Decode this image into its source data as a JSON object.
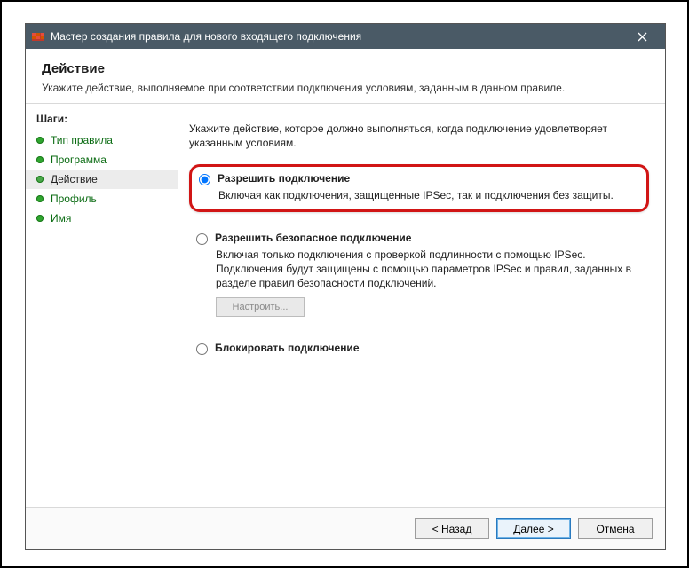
{
  "window": {
    "title": "Мастер создания правила для нового входящего подключения"
  },
  "header": {
    "title": "Действие",
    "subtitle": "Укажите действие, выполняемое при соответствии подключения условиям, заданным в данном правиле."
  },
  "sidebar": {
    "header": "Шаги:",
    "steps": [
      {
        "label": "Тип правила"
      },
      {
        "label": "Программа"
      },
      {
        "label": "Действие",
        "active": true
      },
      {
        "label": "Профиль"
      },
      {
        "label": "Имя"
      }
    ]
  },
  "main": {
    "instruction": "Укажите действие, которое должно выполняться, когда подключение удовлетворяет указанным условиям.",
    "options": {
      "allow": {
        "label": "Разрешить подключение",
        "desc": "Включая как подключения, защищенные IPSec, так и подключения без защиты."
      },
      "allow_secure": {
        "label": "Разрешить безопасное подключение",
        "desc": "Включая только подключения с проверкой подлинности с помощью IPSec. Подключения будут защищены с помощью параметров IPSec и правил, заданных в разделе правил безопасности подключений.",
        "configure": "Настроить..."
      },
      "block": {
        "label": "Блокировать подключение"
      }
    }
  },
  "footer": {
    "back": "< Назад",
    "next": "Далее >",
    "cancel": "Отмена"
  }
}
